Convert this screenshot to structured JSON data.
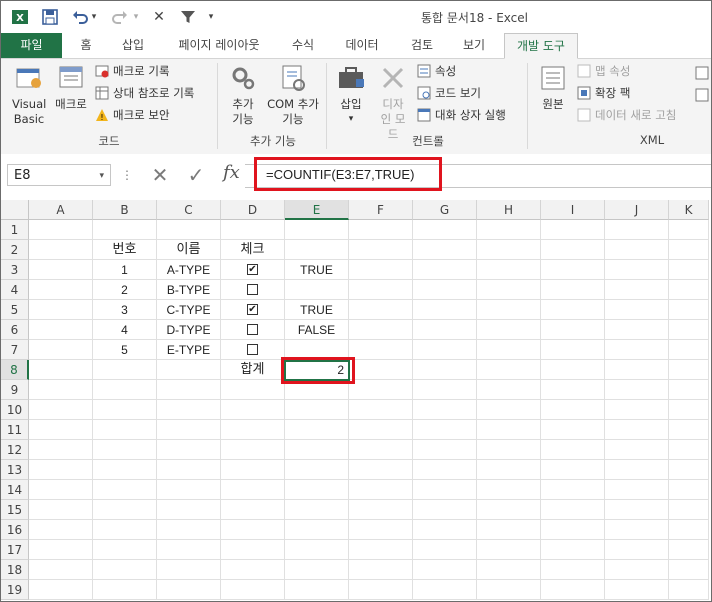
{
  "window": {
    "title": "통합 문서18 - Excel"
  },
  "quick_access": {
    "icons": [
      "excel-logo-icon",
      "save-icon",
      "undo-icon",
      "redo-icon",
      "delete-icon",
      "filter-icon",
      "customize-icon"
    ]
  },
  "tabs": [
    {
      "label": "파일"
    },
    {
      "label": "홈"
    },
    {
      "label": "삽입"
    },
    {
      "label": "페이지 레이아웃"
    },
    {
      "label": "수식"
    },
    {
      "label": "데이터"
    },
    {
      "label": "검토"
    },
    {
      "label": "보기"
    },
    {
      "label": "개발 도구"
    }
  ],
  "ribbon": {
    "code": {
      "label": "코드",
      "visual_basic": "Visual Basic",
      "macro": "매크로",
      "record_macro": "매크로 기록",
      "relative_ref": "상대 참조로 기록",
      "macro_security": "매크로 보안"
    },
    "addins": {
      "label": "추가 기능",
      "addins_btn": "추가 기능",
      "com_addins": "COM 추가 기능"
    },
    "controls": {
      "label": "컨트롤",
      "insert": "삽입",
      "design_mode": "디자인 모드",
      "properties": "속성",
      "view_code": "코드 보기",
      "run_dialog": "대화 상자 실행"
    },
    "xml": {
      "label": "XML",
      "source": "원본",
      "map_properties": "맵 속성",
      "expansion_packs": "확장 팩",
      "refresh_data": "데이터 새로 고침"
    }
  },
  "formula_bar": {
    "name_box": "E8",
    "formula": "=COUNTIF(E3:E7,TRUE)"
  },
  "sheet": {
    "columns": [
      "A",
      "B",
      "C",
      "D",
      "E",
      "F",
      "G",
      "H",
      "I",
      "J",
      "K"
    ],
    "rows": [
      "1",
      "2",
      "3",
      "4",
      "5",
      "6",
      "7",
      "8",
      "9",
      "10",
      "11",
      "12",
      "13",
      "14",
      "15",
      "16",
      "17",
      "18",
      "19"
    ],
    "headers": {
      "no": "번호",
      "name": "이름",
      "check": "체크"
    },
    "data_rows": [
      {
        "no": "1",
        "name": "A-TYPE",
        "checked": true,
        "value": "TRUE"
      },
      {
        "no": "2",
        "name": "B-TYPE",
        "checked": false,
        "value": ""
      },
      {
        "no": "3",
        "name": "C-TYPE",
        "checked": true,
        "value": "TRUE"
      },
      {
        "no": "4",
        "name": "D-TYPE",
        "checked": false,
        "value": "FALSE"
      },
      {
        "no": "5",
        "name": "E-TYPE",
        "checked": false,
        "value": ""
      }
    ],
    "total_label": "합계",
    "total_value": "2",
    "selected_cell": "E8"
  }
}
